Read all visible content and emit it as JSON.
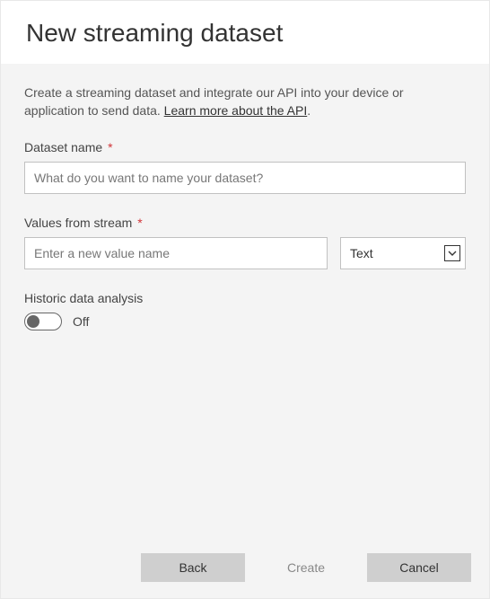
{
  "header": {
    "title": "New streaming dataset"
  },
  "intro": {
    "text_before": "Create a streaming dataset and integrate our API into your device or application to send data. ",
    "link_text": "Learn more about the API",
    "text_after": "."
  },
  "fields": {
    "dataset_name": {
      "label": "Dataset name",
      "required_mark": "*",
      "placeholder": "What do you want to name your dataset?",
      "value": ""
    },
    "values_from_stream": {
      "label": "Values from stream",
      "required_mark": "*",
      "value_placeholder": "Enter a new value name",
      "value": "",
      "type_selected": "Text"
    },
    "historic": {
      "label": "Historic data analysis",
      "state_label": "Off",
      "on": false
    }
  },
  "footer": {
    "back": "Back",
    "create": "Create",
    "cancel": "Cancel"
  }
}
